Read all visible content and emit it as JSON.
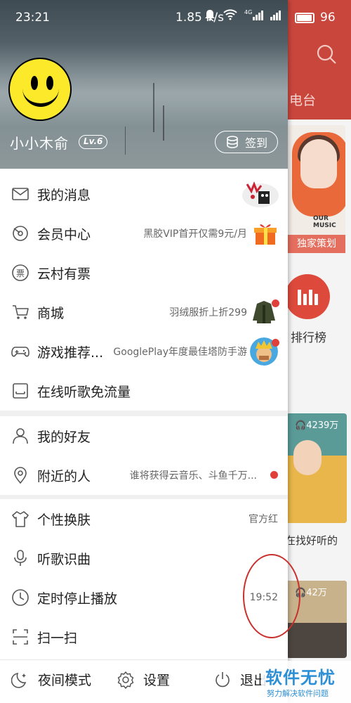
{
  "status_bar": {
    "time": "23:21",
    "speed": "1.85 K/s",
    "battery": "96",
    "battery_level": 0.96,
    "signal_label": "4G"
  },
  "profile": {
    "username": "小小木俞",
    "level": "Lv.6",
    "checkin_label": "签到"
  },
  "menu_sections": [
    [
      {
        "label": "我的消息",
        "hint": ""
      },
      {
        "label": "会员中心",
        "hint": "黑胶VIP首开仅需9元/月"
      },
      {
        "label": "云村有票",
        "hint": ""
      },
      {
        "label": "商城",
        "hint": "羽绒服折上折299"
      },
      {
        "label": "游戏推荐...",
        "hint": "GooglePlay年度最佳塔防手游"
      },
      {
        "label": "在线听歌免流量",
        "hint": ""
      }
    ],
    [
      {
        "label": "我的好友",
        "hint": ""
      },
      {
        "label": "附近的人",
        "hint": "谁将获得云音乐、斗鱼千万..."
      }
    ],
    [
      {
        "label": "个性换肤",
        "hint": "官方红"
      },
      {
        "label": "听歌识曲",
        "hint": ""
      },
      {
        "label": "定时停止播放",
        "hint": "19:52"
      },
      {
        "label": "扫一扫",
        "hint": ""
      }
    ]
  ],
  "bottom_bar": {
    "night_mode": "夜间模式",
    "settings": "设置",
    "exit": "退出"
  },
  "background": {
    "tab_fragment": "电台",
    "banner_tag_line1": "OUR",
    "banner_tag_line2": "MUSIC",
    "banner_label": "独家策划",
    "rank_label": "排行榜",
    "card1_count": "4239万",
    "card1_title": "在找好听的",
    "card2_count": "42万"
  },
  "watermark": {
    "main": "软件无忧",
    "sub": "努力解决软件问题"
  },
  "colors": {
    "accent": "#c9463d",
    "red_dot": "#e0403a",
    "avatar_yellow": "#fce92a"
  }
}
